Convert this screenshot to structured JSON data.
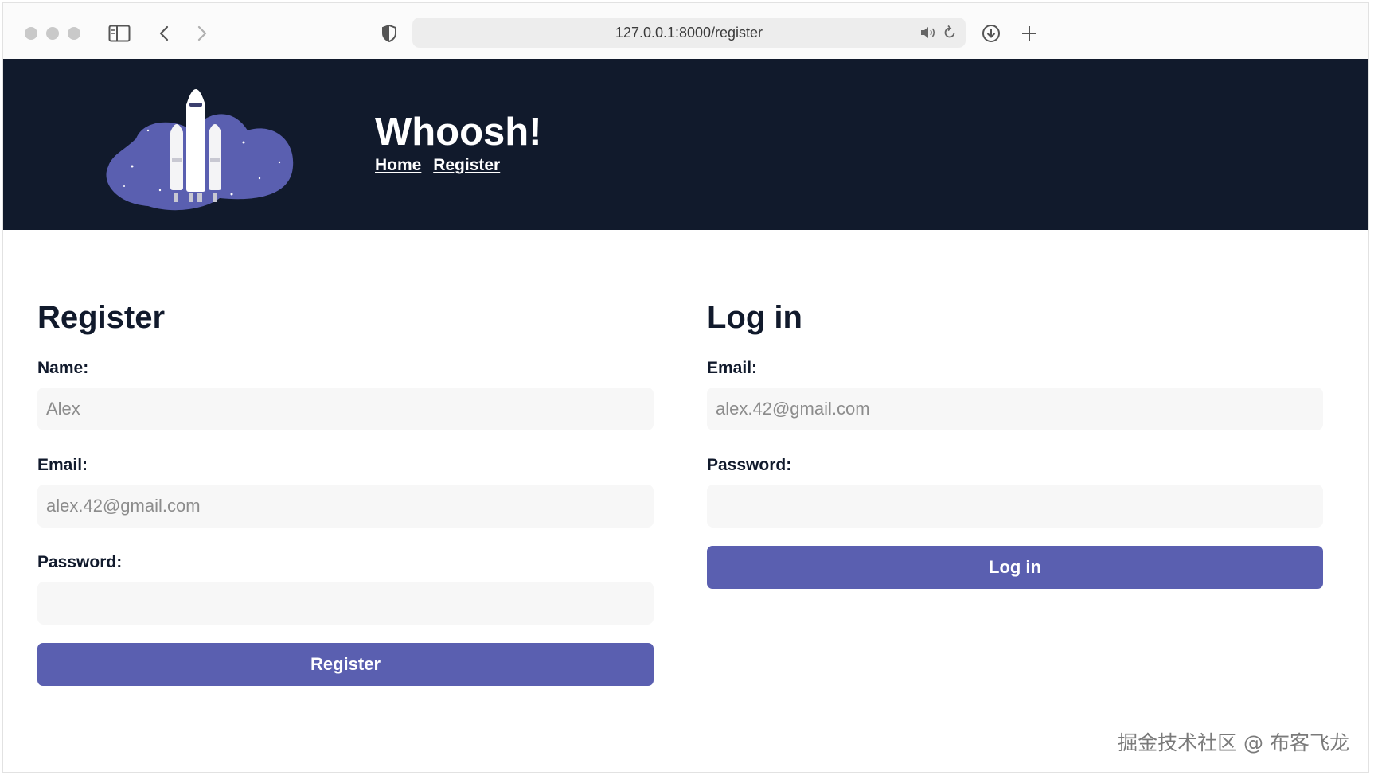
{
  "browser": {
    "url": "127.0.0.1:8000/register"
  },
  "site": {
    "title": "Whoosh!",
    "nav": [
      "Home",
      "Register"
    ]
  },
  "register": {
    "heading": "Register",
    "name_label": "Name:",
    "name_placeholder": "Alex",
    "email_label": "Email:",
    "email_placeholder": "alex.42@gmail.com",
    "password_label": "Password:",
    "button": "Register"
  },
  "login": {
    "heading": "Log in",
    "email_label": "Email:",
    "email_placeholder": "alex.42@gmail.com",
    "password_label": "Password:",
    "button": "Log in"
  },
  "watermark": "掘金技术社区 @ 布客飞龙",
  "colors": {
    "header_bg": "#111a2c",
    "accent": "#5a5fb0",
    "input_bg": "#f7f7f7"
  }
}
